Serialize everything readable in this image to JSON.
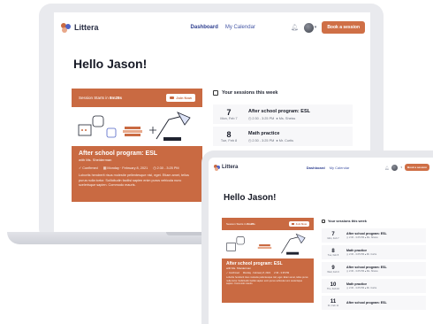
{
  "app": {
    "brand": "Littera",
    "nav": {
      "dashboard": "Dashboard",
      "calendar": "My Calendar"
    },
    "book_button": "Book a session",
    "greeting": "Hello Jason!"
  },
  "next_session": {
    "starts_in": "Session Starts in",
    "starts_value": "8m28s",
    "join_label": "Join Now",
    "title": "After school program: ESL",
    "teacher": "with Ms. Sheiderman",
    "status": "Confirmed",
    "date": "Monday · February 8, 2021",
    "time": "2:30 - 3:25 PM",
    "description": "Lobortis hendrerit risus molestie pellentesque nisl, eget. Etiam amet, tellus purus nulla tortor. Sollicitudin facilisi sapien enim purus vehicula nunc scelerisque sapien. Commodo mauris."
  },
  "sessions": {
    "heading": "Your sessions this week",
    "items": [
      {
        "day": "7",
        "weekday": "Mon, Feb 7",
        "title": "After school program: ESL",
        "time": "2:30 - 3:25 PM",
        "tutor": "Ms. Sheiss"
      },
      {
        "day": "8",
        "weekday": "Tue, Feb 8",
        "title": "Math practice",
        "time": "2:30 - 3:25 PM",
        "tutor": "Mr. Curtis"
      },
      {
        "day": "9",
        "weekday": "Wed, Feb 9",
        "title": "After school program: ESL",
        "time": "2:30 - 3:25 PM",
        "tutor": "Ms. Sheiss"
      },
      {
        "day": "10",
        "weekday": "Thu, Feb 10",
        "title": "Math practice",
        "time": "2:30 - 3:25 PM",
        "tutor": "Mr. Curtis"
      },
      {
        "day": "11",
        "weekday": "Fri, Feb 11",
        "title": "After school program: ESL",
        "time": "",
        "tutor": ""
      }
    ]
  },
  "colors": {
    "accent": "#c96a42",
    "nav_active": "#2d3e8f",
    "bg": "#ffffff"
  },
  "icons": [
    "logo-mark",
    "bell-icon",
    "avatar",
    "chevron-down-icon",
    "video-icon",
    "check-icon",
    "calendar-icon",
    "clock-icon",
    "user-icon"
  ]
}
